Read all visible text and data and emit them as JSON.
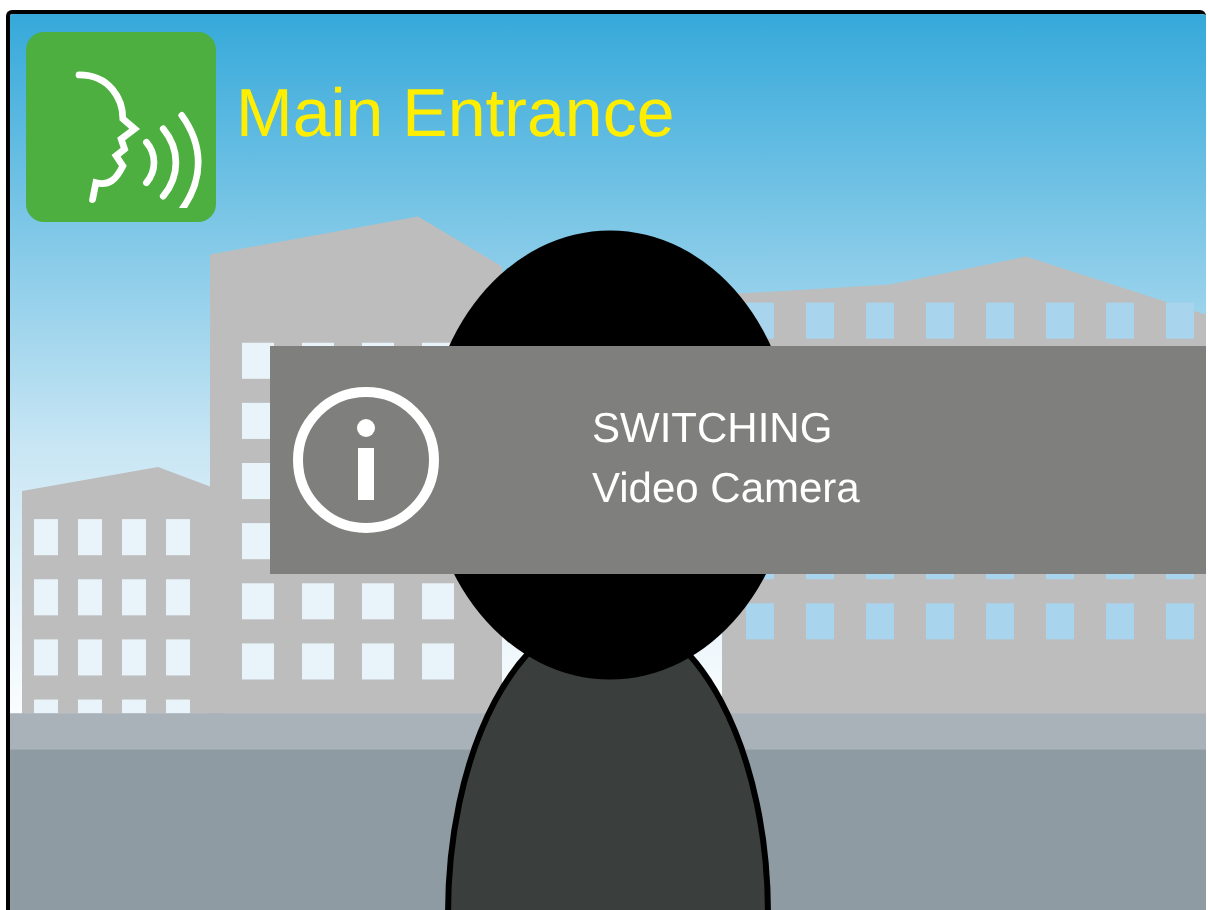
{
  "camera": {
    "name": "Main Entrance"
  },
  "notification": {
    "kind": "info",
    "title": "SWITCHING",
    "message": "Video Camera"
  }
}
